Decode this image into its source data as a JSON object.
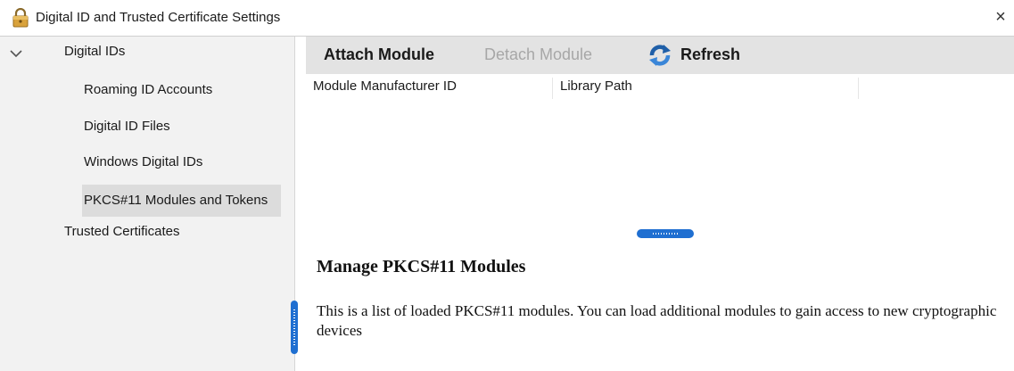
{
  "window": {
    "title": "Digital ID and Trusted Certificate Settings",
    "close_symbol": "×",
    "icon": "lock-icon"
  },
  "sidebar": {
    "group_label": "Digital IDs",
    "group_icon": "chevron-down-icon",
    "items": [
      {
        "label": "Roaming ID Accounts",
        "selected": false
      },
      {
        "label": "Digital ID Files",
        "selected": false
      },
      {
        "label": "Windows Digital IDs",
        "selected": false
      },
      {
        "label": "PKCS#11 Modules and Tokens",
        "selected": true
      }
    ],
    "trusted_label": "Trusted Certificates"
  },
  "toolbar": {
    "attach_label": "Attach Module",
    "detach_label": "Detach Module",
    "refresh_label": "Refresh",
    "refresh_icon": "refresh-icon"
  },
  "table": {
    "columns": [
      "Module Manufacturer ID",
      "Library Path"
    ],
    "rows": []
  },
  "help": {
    "title": "Manage PKCS#11 Modules",
    "body": "This is a list of loaded PKCS#11 modules. You can load additional modules to gain access to new cryptographic devices"
  },
  "colors": {
    "accent": "#1f6fd1",
    "toolbar_bg": "#e3e3e3",
    "sidebar_bg": "#f2f2f2",
    "selected_bg": "#dcdcdc",
    "disabled_text": "#a7a7a7"
  }
}
